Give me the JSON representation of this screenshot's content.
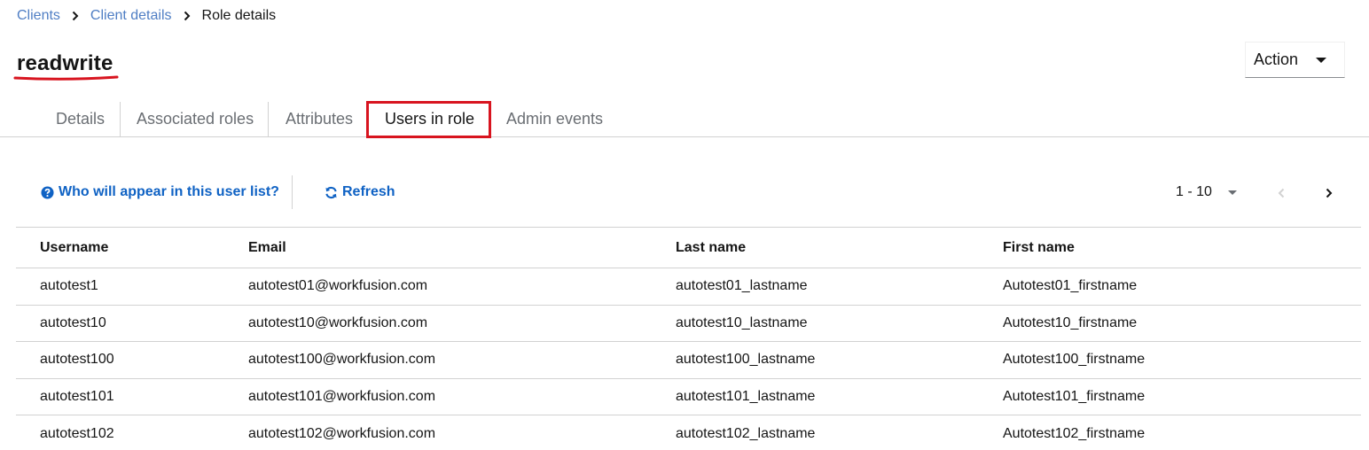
{
  "breadcrumb": {
    "items": [
      "Clients",
      "Client details"
    ],
    "current": "Role details"
  },
  "page": {
    "title": "readwrite",
    "action_label": "Action"
  },
  "tabs": [
    {
      "label": "Details"
    },
    {
      "label": "Associated roles"
    },
    {
      "label": "Attributes"
    },
    {
      "label": "Users in role",
      "active": true
    },
    {
      "label": "Admin events"
    }
  ],
  "toolbar": {
    "help_label": "Who will appear in this user list?",
    "refresh_label": "Refresh",
    "pagination_range": "1 - 10"
  },
  "table": {
    "columns": [
      "Username",
      "Email",
      "Last name",
      "First name"
    ],
    "rows": [
      [
        "autotest1",
        "autotest01@workfusion.com",
        "autotest01_lastname",
        "Autotest01_firstname"
      ],
      [
        "autotest10",
        "autotest10@workfusion.com",
        "autotest10_lastname",
        "Autotest10_firstname"
      ],
      [
        "autotest100",
        "autotest100@workfusion.com",
        "autotest100_lastname",
        "Autotest100_firstname"
      ],
      [
        "autotest101",
        "autotest101@workfusion.com",
        "autotest101_lastname",
        "Autotest101_firstname"
      ],
      [
        "autotest102",
        "autotest102@workfusion.com",
        "autotest102_lastname",
        "Autotest102_firstname"
      ]
    ]
  },
  "colors": {
    "link": "#0f62c4",
    "breadcrumb_link": "#4f7ec4",
    "highlight": "#d8141f",
    "tab_text": "#6a6e73"
  },
  "icons": {
    "breadcrumb_separator": "chevron-right-icon",
    "action_dropdown": "caret-down-icon",
    "help": "question-circle-icon",
    "refresh": "sync-icon",
    "pager_prev": "chevron-left-icon",
    "pager_next": "chevron-right-icon"
  }
}
